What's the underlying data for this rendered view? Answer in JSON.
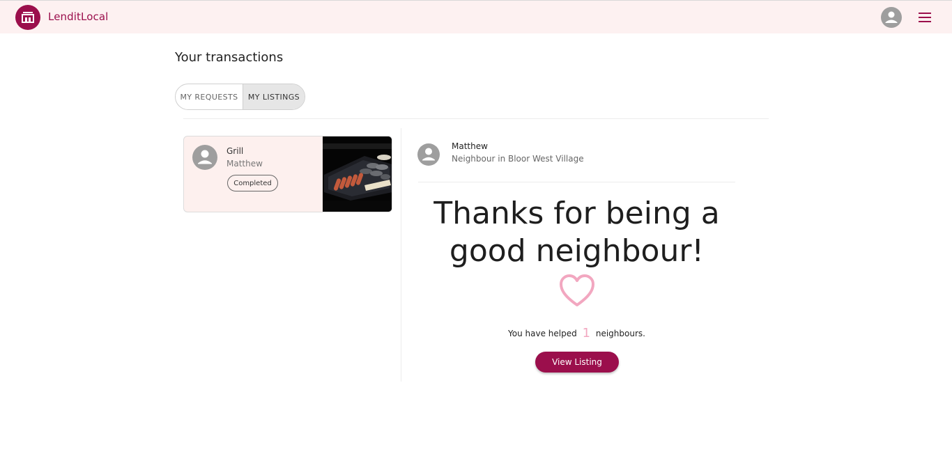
{
  "app": {
    "brand": "LenditLocal",
    "logo_icon": "store-icon",
    "brand_color": "#9b0f4c",
    "account_icon": "account-circle-icon",
    "menu_icon": "hamburger-menu-icon"
  },
  "page": {
    "title": "Your transactions"
  },
  "tabs": [
    {
      "label": "MY REQUESTS",
      "selected": false
    },
    {
      "label": "MY LISTINGS",
      "selected": true
    }
  ],
  "transactions": [
    {
      "item": "Grill",
      "owner": "Matthew",
      "status": "Completed",
      "avatar_icon": "account-circle-icon",
      "image": "grill-photo"
    }
  ],
  "detail": {
    "user_name": "Matthew",
    "user_subtitle": "Neighbour in Bloor West Village",
    "headline_line1": "Thanks for being a",
    "headline_line2": "good neighbour!",
    "heart_icon": "heart-outline-icon",
    "heart_color": "#f2a7c0",
    "helped_prefix": "You have helped",
    "helped_count": "1",
    "helped_suffix": "neighbours.",
    "cta_label": "View Listing"
  }
}
